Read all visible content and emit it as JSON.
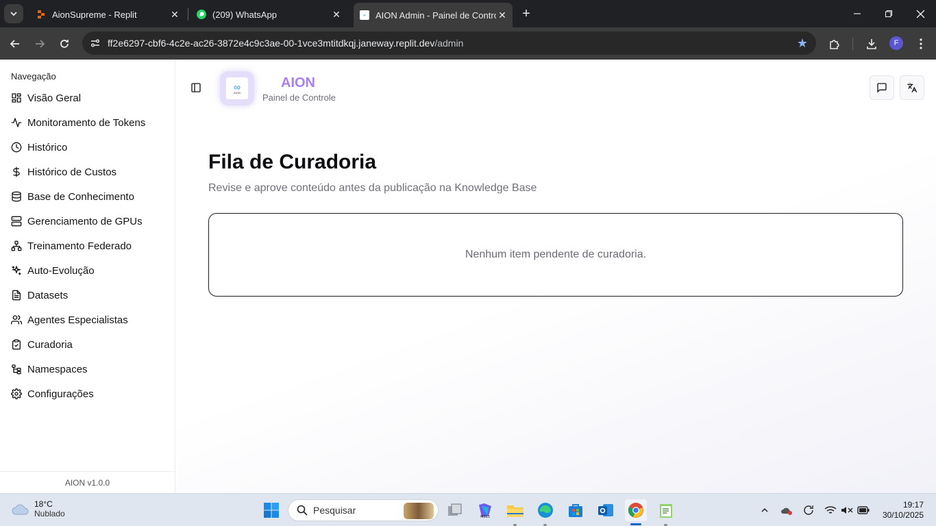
{
  "browser": {
    "tabs": [
      {
        "title": "AionSupreme - Replit",
        "icon": "replit-icon"
      },
      {
        "title": "(209) WhatsApp",
        "icon": "whatsapp-icon"
      },
      {
        "title": "AION Admin - Painel de Controle",
        "icon": "aion-favicon-icon"
      }
    ],
    "url_host": "ff2e6297-cbf6-4c2e-ac26-3872e4c9c3ae-00-1vce3mtitdkqj.janeway.replit.dev",
    "url_path": "/admin",
    "profile_initial": "F"
  },
  "sidebar": {
    "group_label": "Navegação",
    "items": [
      {
        "label": "Visão Geral",
        "icon": "layout-grid-icon"
      },
      {
        "label": "Monitoramento de Tokens",
        "icon": "activity-icon"
      },
      {
        "label": "Histórico",
        "icon": "clock-icon"
      },
      {
        "label": "Histórico de Custos",
        "icon": "dollar-icon"
      },
      {
        "label": "Base de Conhecimento",
        "icon": "database-icon"
      },
      {
        "label": "Gerenciamento de GPUs",
        "icon": "server-icon"
      },
      {
        "label": "Treinamento Federado",
        "icon": "network-icon"
      },
      {
        "label": "Auto-Evolução",
        "icon": "sparkles-icon"
      },
      {
        "label": "Datasets",
        "icon": "file-text-icon"
      },
      {
        "label": "Agentes Especialistas",
        "icon": "users-icon"
      },
      {
        "label": "Curadoria",
        "icon": "clipboard-check-icon"
      },
      {
        "label": "Namespaces",
        "icon": "tree-icon"
      },
      {
        "label": "Configurações",
        "icon": "gear-icon"
      }
    ],
    "footer": "AION v1.0.0"
  },
  "header": {
    "brand": "AION",
    "subtitle": "Painel de Controle",
    "logo_small_text": "AION"
  },
  "main": {
    "title": "Fila de Curadoria",
    "subtitle": "Revise e aprove conteúdo antes da publicação na Knowledge Base",
    "empty_message": "Nenhum item pendente de curadoria."
  },
  "taskbar": {
    "temperature": "18°C",
    "weather": "Nublado",
    "search_placeholder": "Pesquisar",
    "time": "19:17",
    "date": "30/10/2025"
  }
}
